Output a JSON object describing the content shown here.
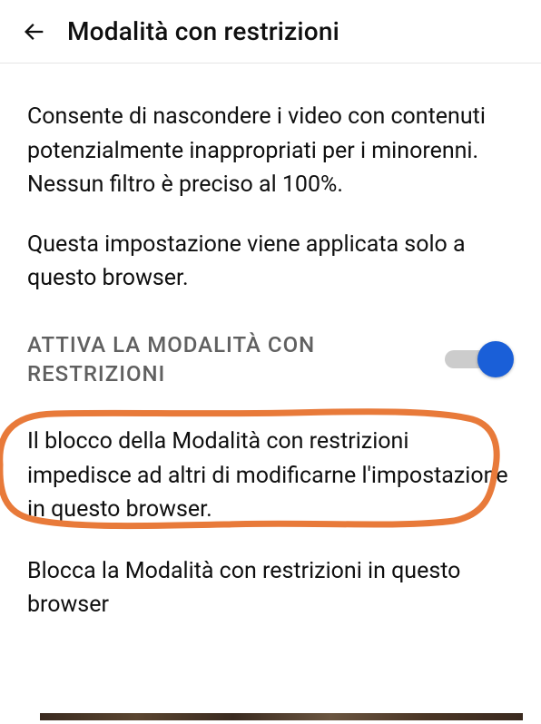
{
  "header": {
    "title": "Modalità con restrizioni"
  },
  "content": {
    "description1": "Consente di nascondere i video con contenuti potenzialmente inappropriati per i minorenni. Nessun filtro è preciso al 100%.",
    "description2": "Questa impostazione viene applicata solo a questo browser.",
    "toggle": {
      "label": "ATTIVA LA MODALITÀ CON RESTRIZIONI",
      "enabled": true
    },
    "lock_description": "Il blocco della Modalità con restrizioni impedisce ad altri di modificarne l'impostazione in questo browser.",
    "lock_action": "Blocca la Modalità con restrizioni in questo browser"
  },
  "annotation": {
    "color": "#e87a3a"
  }
}
